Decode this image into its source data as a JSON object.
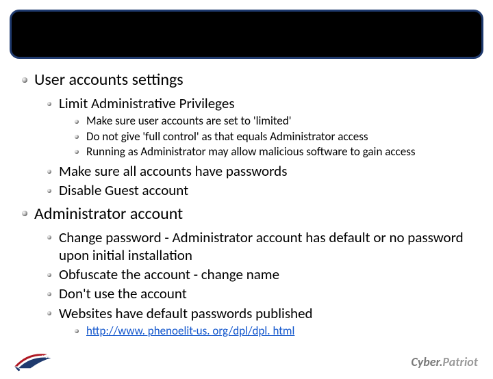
{
  "title_bar": {
    "text": ""
  },
  "sections": {
    "user_accounts": {
      "heading": "User accounts settings",
      "limit_privs": {
        "heading": "Limit Administrative Privileges",
        "items": [
          "Make sure user accounts are set to 'limited'",
          "Do not give 'full control' as that equals Administrator access",
          "Running as Administrator  may allow malicious software to gain access"
        ]
      },
      "other": [
        "Make sure all accounts have passwords",
        "Disable Guest account"
      ]
    },
    "admin_account": {
      "heading": "Administrator account",
      "items": [
        "Change password - Administrator account has default or no password upon initial installation",
        "Obfuscate the account - change name",
        "Don't use the account",
        "Websites have default passwords published"
      ],
      "link": {
        "text": "http://www. phenoelit-us. org/dpl/dpl. html",
        "href": "http://www.phenoelit-us.org/dpl/dpl.html"
      }
    }
  },
  "footer": {
    "brand_part1": "Cyber.",
    "brand_part2": "Patriot"
  }
}
